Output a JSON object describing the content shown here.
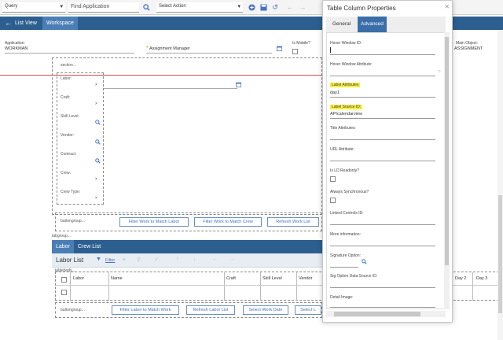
{
  "toolbar": {
    "query_select": "Query",
    "find_placeholder": "Find Application",
    "action_select": "Select Action"
  },
  "nav": {
    "list_view": "List View",
    "workspace": "Workspace"
  },
  "header": {
    "application_label": "Application:",
    "application_value": "WORKMAN",
    "assignment_manager": "Assignment Manager",
    "is_mobile_label": "Is Mobile?",
    "main_object_label": "Main Object:",
    "main_object_value": "ASSIGNMENT"
  },
  "designer": {
    "section_label": "section...",
    "fields": [
      "Labor:",
      "Craft:",
      "Skill Level:",
      "Vendor:",
      "Contract:",
      "Crew:",
      "Crew Type:"
    ],
    "buttongroup_label": "buttongroup...",
    "buttons": [
      "Filter Work to Match Labor",
      "Filter Work to Match Crew",
      "Refresh Work List"
    ],
    "tabgroup_label": "tabgroup..."
  },
  "lower": {
    "tabs": [
      "Labor",
      "Crew List"
    ],
    "list_title": "Labor List",
    "filter_label": "Filter",
    "table_label": "tablebody...",
    "columns": [
      "Labor",
      "Name",
      "Craft",
      "Skill Level",
      "Vendor"
    ],
    "day_columns": [
      "Day 2",
      "Day 3"
    ],
    "buttongroup_label": "buttongroup...",
    "buttons": [
      "Filter Labor to Match Work",
      "Refresh Labor List",
      "Select Work Date",
      "Select L"
    ]
  },
  "dialog": {
    "title": "Table Column Properties",
    "tabs": [
      "General",
      "Advanced"
    ],
    "hover_window_id_label": "Hover Window ID:",
    "hover_window_id_value": "",
    "hover_window_attr_label": "Hover Window Attribute:",
    "label_attributes_label": "Label Attributes",
    "label_attributes_value": "day1",
    "label_source_id_label": "Label Source ID:",
    "label_source_id_value": "APIcalendarview",
    "title_attributes_label": "Title Attributes:",
    "url_attribute_label": "URL Attribute:",
    "is_ld_readonly_label": "Is LD Readonly?",
    "always_sync_label": "Always Synchronous?",
    "linked_controls_label": "Linked Controls ID:",
    "more_info_label": "More information:",
    "signature_option_label": "Signature Option:",
    "sig_option_ds_label": "Sig Option Data Source ID:",
    "detail_image_label": "Detail Image:"
  },
  "colors": {
    "nav_blue": "#2c5f8f",
    "active_tab": "#4b7eb5",
    "highlight": "#f6f03a",
    "link_blue": "#4472c4"
  }
}
